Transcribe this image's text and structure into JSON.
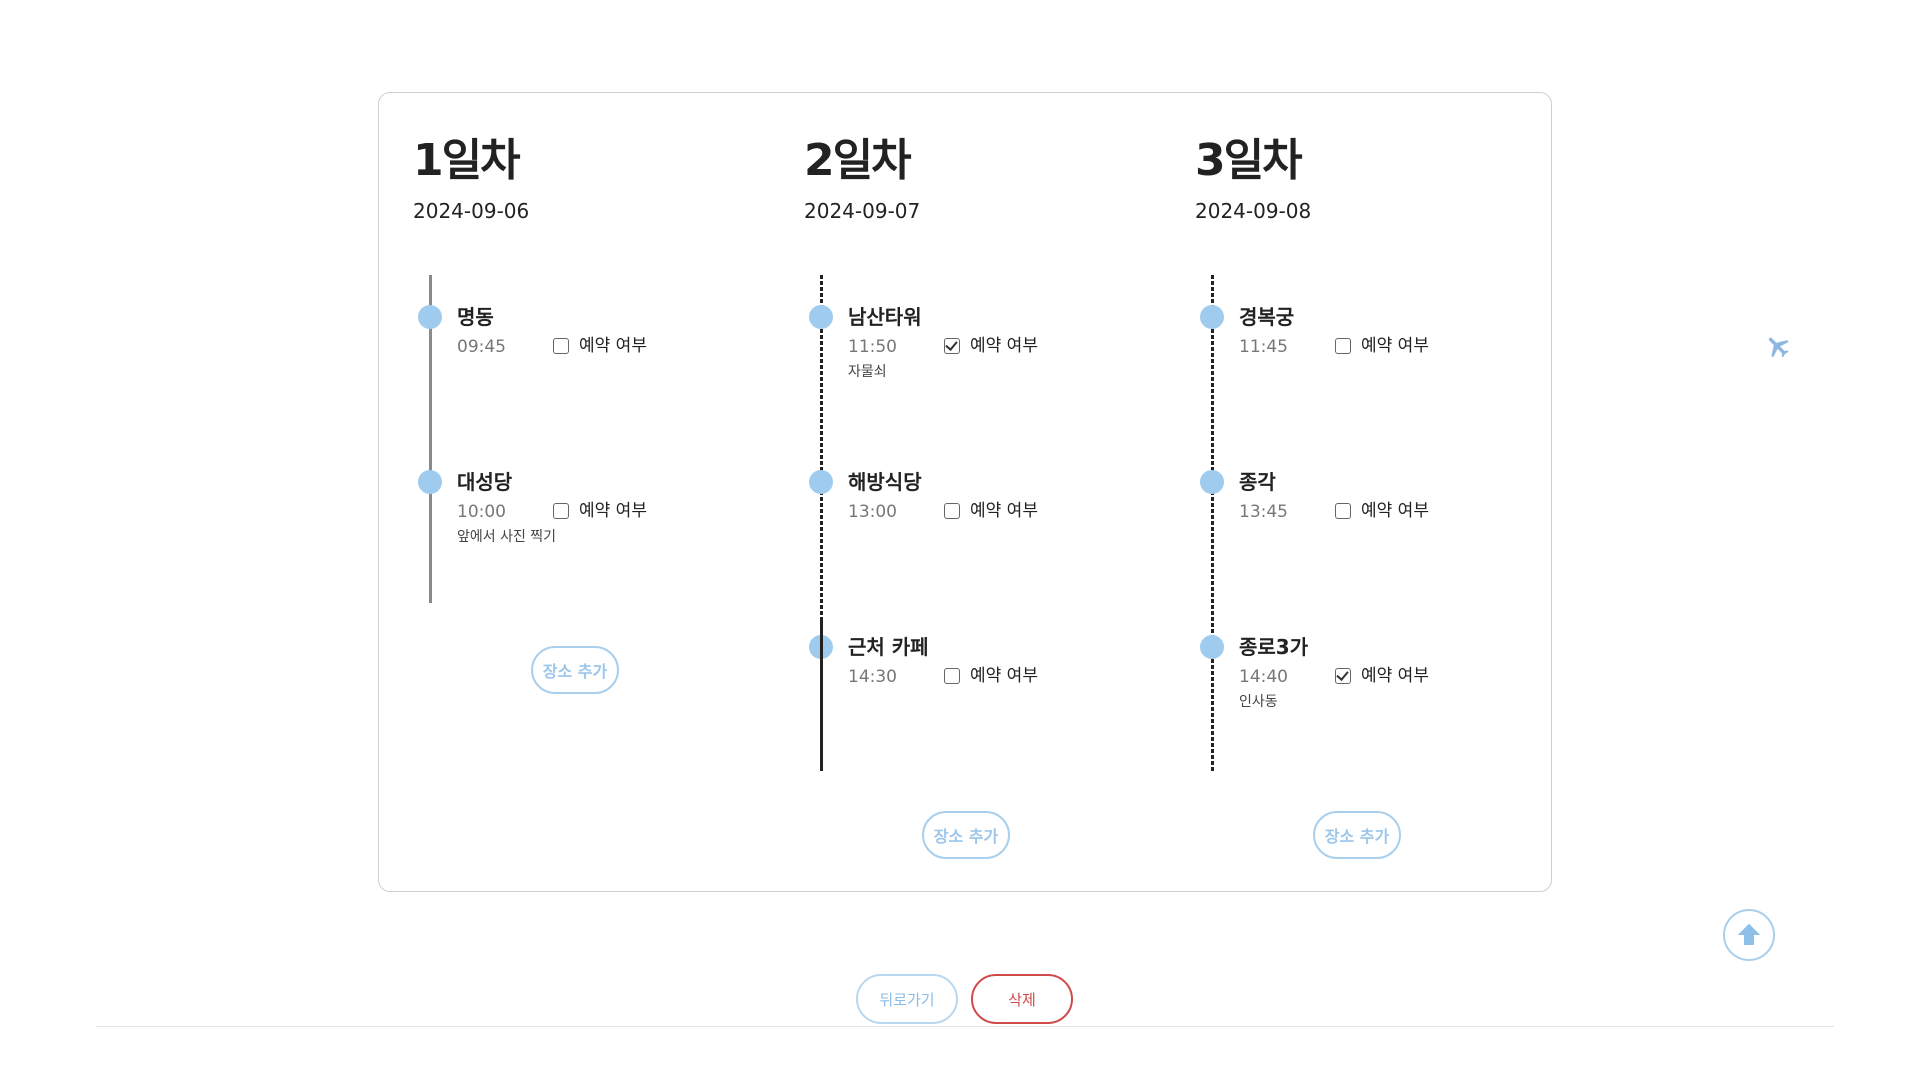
{
  "reserve_label": "예약 여부",
  "add_place_label": "장소 추가",
  "days": [
    {
      "title": "1일차",
      "date": "2024-09-06",
      "places": [
        {
          "name": "명동",
          "time": "09:45",
          "reserved": false,
          "memo": ""
        },
        {
          "name": "대성당",
          "time": "10:00",
          "reserved": false,
          "memo": "앞에서 사진 찍기"
        }
      ]
    },
    {
      "title": "2일차",
      "date": "2024-09-07",
      "places": [
        {
          "name": "남산타워",
          "time": "11:50",
          "reserved": true,
          "memo": "자물쇠"
        },
        {
          "name": "해방식당",
          "time": "13:00",
          "reserved": false,
          "memo": ""
        },
        {
          "name": "근처 카페",
          "time": "14:30",
          "reserved": false,
          "memo": ""
        }
      ]
    },
    {
      "title": "3일차",
      "date": "2024-09-08",
      "places": [
        {
          "name": "경복궁",
          "time": "11:45",
          "reserved": false,
          "memo": ""
        },
        {
          "name": "종각",
          "time": "13:45",
          "reserved": false,
          "memo": ""
        },
        {
          "name": "종로3가",
          "time": "14:40",
          "reserved": true,
          "memo": "인사동"
        }
      ]
    }
  ],
  "buttons": {
    "back": "뒤로가기",
    "delete": "삭제"
  },
  "colors": {
    "accent": "#9fccee",
    "danger": "#cf4a4a"
  },
  "icons": {
    "floating": "airplane-icon",
    "scroll_top": "arrow-up-icon"
  }
}
